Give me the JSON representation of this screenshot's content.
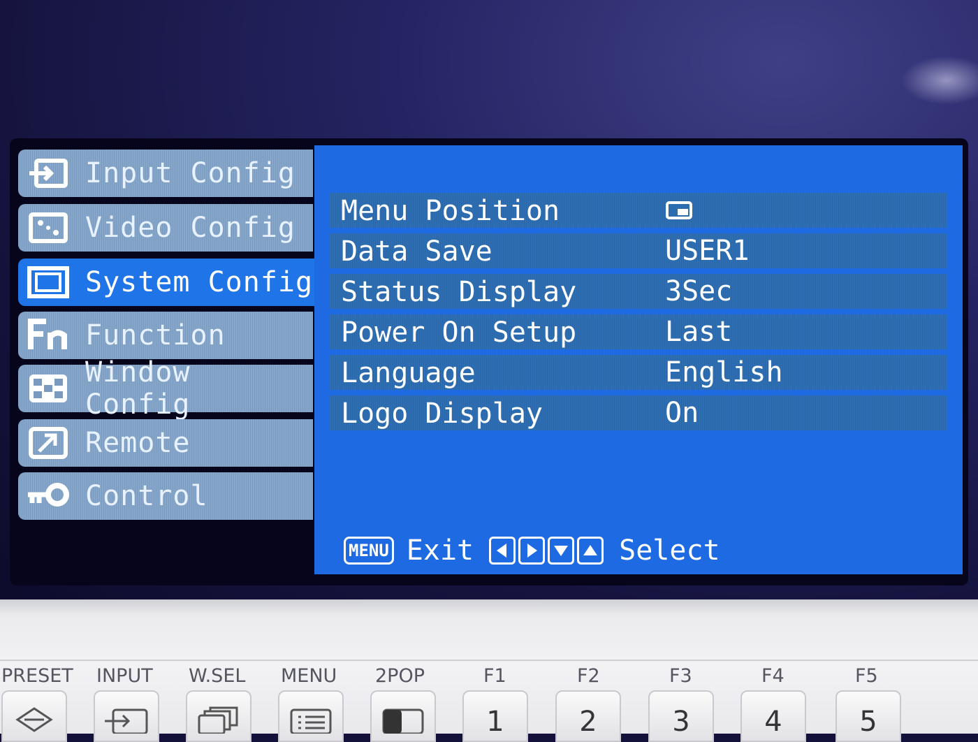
{
  "nav": {
    "items": [
      {
        "label": "Input Config",
        "icon": "input-arrow-icon"
      },
      {
        "label": "Video Config",
        "icon": "video-config-icon"
      },
      {
        "label": "System Config",
        "icon": "system-config-icon",
        "active": true
      },
      {
        "label": "Function",
        "icon": "fn-icon"
      },
      {
        "label": "Window Config",
        "icon": "window-config-icon"
      },
      {
        "label": "Remote",
        "icon": "remote-arrow-icon"
      },
      {
        "label": "Control",
        "icon": "control-key-icon"
      }
    ]
  },
  "settings": {
    "rows": [
      {
        "label": "Menu Position",
        "value": "",
        "value_icon": "menu-position-icon"
      },
      {
        "label": "Data Save",
        "value": "USER1"
      },
      {
        "label": "Status Display",
        "value": "3Sec"
      },
      {
        "label": "Power On Setup",
        "value": "Last"
      },
      {
        "label": "Language",
        "value": "English"
      },
      {
        "label": "Logo Display",
        "value": "On"
      }
    ]
  },
  "footer": {
    "menu_key": "MENU",
    "exit_label": "Exit",
    "select_label": "Select",
    "arrow_icons": [
      "arrow-left-icon",
      "arrow-right-icon",
      "arrow-down-icon",
      "arrow-up-icon"
    ]
  },
  "hardware": {
    "buttons": [
      {
        "label": "PRESET",
        "icon": "preset-icon"
      },
      {
        "label": "INPUT",
        "icon": "input-icon"
      },
      {
        "label": "W.SEL",
        "icon": "window-select-icon"
      },
      {
        "label": "MENU",
        "icon": "menu-list-icon"
      },
      {
        "label": "2POP",
        "icon": "two-pop-icon"
      },
      {
        "label": "F1",
        "key": "1"
      },
      {
        "label": "F2",
        "key": "2"
      },
      {
        "label": "F3",
        "key": "3"
      },
      {
        "label": "F4",
        "key": "4"
      },
      {
        "label": "F5",
        "key": "5"
      }
    ]
  },
  "colors": {
    "panel_blue": "#1e6ae2",
    "active_blue": "#1f74e8",
    "nav_grey_blue": "#86a7c9",
    "row_blue": "#2d6fb2"
  }
}
